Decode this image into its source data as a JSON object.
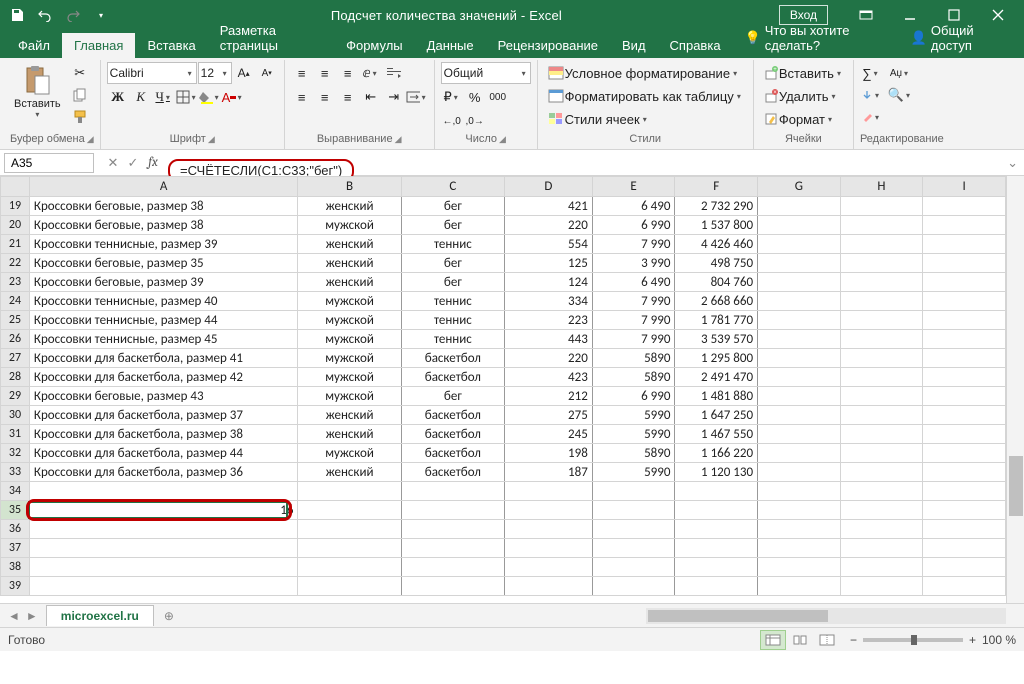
{
  "title": "Подсчет количества значений  -  Excel",
  "signin": "Вход",
  "tabs": {
    "file": "Файл",
    "home": "Главная",
    "insert": "Вставка",
    "layout": "Разметка страницы",
    "formulas": "Формулы",
    "data": "Данные",
    "review": "Рецензирование",
    "view": "Вид",
    "help": "Справка",
    "tellme": "Что вы хотите сделать?",
    "share": "Общий доступ"
  },
  "ribbon": {
    "paste": "Вставить",
    "clipboard": "Буфер обмена",
    "font_name": "Calibri",
    "font_size": "12",
    "font_group": "Шрифт",
    "align_group": "Выравнивание",
    "num_format": "Общий",
    "number_group": "Число",
    "cond_format": "Условное форматирование",
    "format_table": "Форматировать как таблицу",
    "cell_styles": "Стили ячеек",
    "styles_group": "Стили",
    "insert_btn": "Вставить",
    "delete_btn": "Удалить",
    "format_btn": "Формат",
    "cells_group": "Ячейки",
    "editing_group": "Редактирование"
  },
  "namebox": "A35",
  "formula": "=СЧЁТЕСЛИ(C1:C33;\"бег\")",
  "cols": [
    "A",
    "B",
    "C",
    "D",
    "E",
    "F",
    "G",
    "H",
    "I"
  ],
  "rows_start": 19,
  "table": [
    [
      "Кроссовки беговые, размер 38",
      "женский",
      "бег",
      "421",
      "6 490",
      "2 732 290"
    ],
    [
      "Кроссовки беговые, размер 38",
      "мужской",
      "бег",
      "220",
      "6 990",
      "1 537 800"
    ],
    [
      "Кроссовки теннисные, размер 39",
      "женский",
      "теннис",
      "554",
      "7 990",
      "4 426 460"
    ],
    [
      "Кроссовки беговые, размер 35",
      "женский",
      "бег",
      "125",
      "3 990",
      "498 750"
    ],
    [
      "Кроссовки беговые, размер 39",
      "женский",
      "бег",
      "124",
      "6 490",
      "804 760"
    ],
    [
      "Кроссовки теннисные, размер 40",
      "мужской",
      "теннис",
      "334",
      "7 990",
      "2 668 660"
    ],
    [
      "Кроссовки теннисные, размер 44",
      "мужской",
      "теннис",
      "223",
      "7 990",
      "1 781 770"
    ],
    [
      "Кроссовки теннисные, размер 45",
      "мужской",
      "теннис",
      "443",
      "7 990",
      "3 539 570"
    ],
    [
      "Кроссовки для баскетбола, размер 41",
      "мужской",
      "баскетбол",
      "220",
      "5890",
      "1 295 800"
    ],
    [
      "Кроссовки для баскетбола, размер 42",
      "мужской",
      "баскетбол",
      "423",
      "5890",
      "2 491 470"
    ],
    [
      "Кроссовки беговые, размер 43",
      "мужской",
      "бег",
      "212",
      "6 990",
      "1 481 880"
    ],
    [
      "Кроссовки для баскетбола, размер 37",
      "женский",
      "баскетбол",
      "275",
      "5990",
      "1 647 250"
    ],
    [
      "Кроссовки для баскетбола, размер 38",
      "женский",
      "баскетбол",
      "245",
      "5990",
      "1 467 550"
    ],
    [
      "Кроссовки для баскетбола, размер 44",
      "мужской",
      "баскетбол",
      "198",
      "5890",
      "1 166 220"
    ],
    [
      "Кроссовки для баскетбола, размер 36",
      "женский",
      "баскетбол",
      "187",
      "5990",
      "1 120 130"
    ]
  ],
  "result_row": 35,
  "result_val": "16",
  "empty_rows": [
    34,
    36,
    37,
    38,
    39
  ],
  "sheet_name": "microexcel.ru",
  "status": "Готово",
  "zoom": "100 %"
}
